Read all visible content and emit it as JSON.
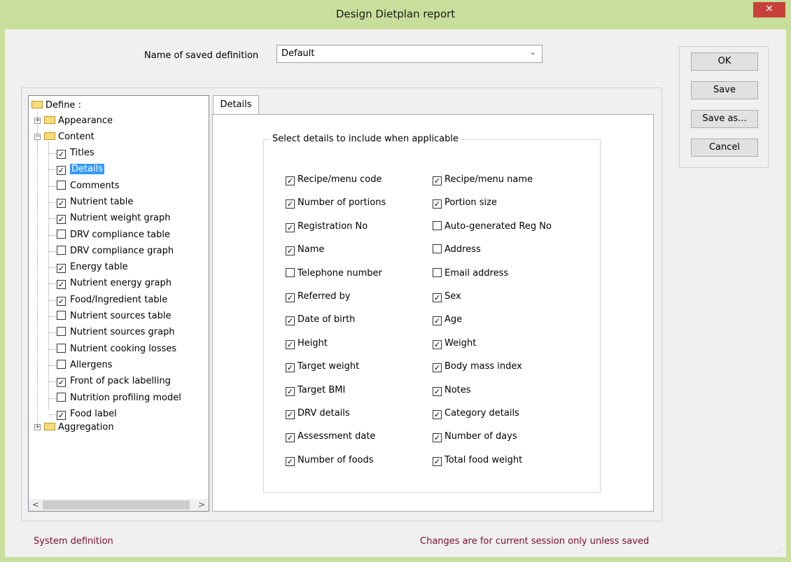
{
  "window": {
    "title": "Design Dietplan report",
    "close_glyph": "✕"
  },
  "definition": {
    "label": "Name of saved definition",
    "value": "Default"
  },
  "buttons": {
    "ok": "OK",
    "save": "Save",
    "save_as": "Save as...",
    "cancel": "Cancel"
  },
  "tree": {
    "root": "Define :",
    "appearance": "Appearance",
    "content": "Content",
    "aggregation": "Aggregation",
    "items": [
      {
        "label": "Titles",
        "checked": true,
        "selected": false
      },
      {
        "label": "Details",
        "checked": true,
        "selected": true
      },
      {
        "label": "Comments",
        "checked": false,
        "selected": false
      },
      {
        "label": "Nutrient table",
        "checked": true,
        "selected": false
      },
      {
        "label": "Nutrient weight graph",
        "checked": true,
        "selected": false
      },
      {
        "label": "DRV compliance table",
        "checked": false,
        "selected": false
      },
      {
        "label": "DRV compliance graph",
        "checked": false,
        "selected": false
      },
      {
        "label": "Energy table",
        "checked": true,
        "selected": false
      },
      {
        "label": "Nutrient energy graph",
        "checked": true,
        "selected": false
      },
      {
        "label": "Food/Ingredient table",
        "checked": true,
        "selected": false
      },
      {
        "label": "Nutrient sources table",
        "checked": false,
        "selected": false
      },
      {
        "label": "Nutrient sources graph",
        "checked": false,
        "selected": false
      },
      {
        "label": "Nutrient cooking losses",
        "checked": false,
        "selected": false
      },
      {
        "label": "Allergens",
        "checked": false,
        "selected": false
      },
      {
        "label": "Front of pack labelling",
        "checked": true,
        "selected": false
      },
      {
        "label": "Nutrition profiling model",
        "checked": false,
        "selected": false
      },
      {
        "label": "Food label",
        "checked": true,
        "selected": false
      }
    ]
  },
  "tab": {
    "label": "Details"
  },
  "details": {
    "legend": "Select details to include when applicable",
    "left": [
      {
        "label": "Recipe/menu code",
        "checked": true
      },
      {
        "label": "Number of portions",
        "checked": true
      },
      {
        "label": "Registration No",
        "checked": true
      },
      {
        "label": "Name",
        "checked": true
      },
      {
        "label": "Telephone number",
        "checked": false
      },
      {
        "label": "Referred by",
        "checked": true
      },
      {
        "label": "Date of birth",
        "checked": true
      },
      {
        "label": "Height",
        "checked": true
      },
      {
        "label": "Target weight",
        "checked": true
      },
      {
        "label": "Target BMI",
        "checked": true
      },
      {
        "label": "DRV details",
        "checked": true
      },
      {
        "label": "Assessment date",
        "checked": true
      },
      {
        "label": "Number of foods",
        "checked": true
      }
    ],
    "right": [
      {
        "label": "Recipe/menu name",
        "checked": true
      },
      {
        "label": "Portion size",
        "checked": true
      },
      {
        "label": "Auto-generated Reg No",
        "checked": false
      },
      {
        "label": "Address",
        "checked": false
      },
      {
        "label": "Email address",
        "checked": false
      },
      {
        "label": "Sex",
        "checked": true
      },
      {
        "label": "Age",
        "checked": true
      },
      {
        "label": "Weight",
        "checked": true
      },
      {
        "label": "Body mass index",
        "checked": true
      },
      {
        "label": "Notes",
        "checked": true
      },
      {
        "label": "Category details",
        "checked": true
      },
      {
        "label": "Number of days",
        "checked": true
      },
      {
        "label": "Total food weight",
        "checked": true
      }
    ]
  },
  "status": {
    "left": "System definition",
    "right": "Changes are for current session only unless saved"
  }
}
